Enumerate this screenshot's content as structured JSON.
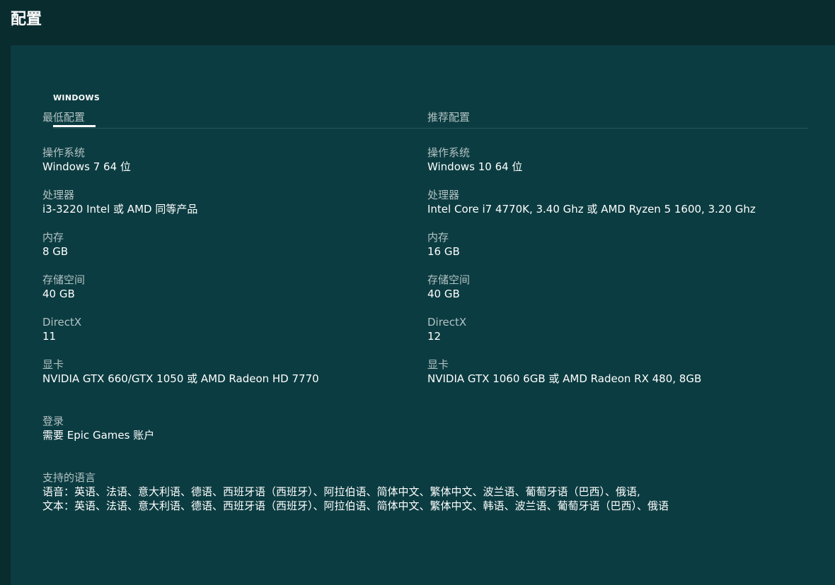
{
  "page": {
    "title": "配置"
  },
  "tabs": [
    {
      "label": "WINDOWS",
      "active": true
    }
  ],
  "minimum": {
    "heading": "最低配置",
    "specs": [
      {
        "label": "操作系统",
        "value": "Windows 7 64 位"
      },
      {
        "label": "处理器",
        "value": "i3-3220 Intel 或 AMD 同等产品"
      },
      {
        "label": "内存",
        "value": "8 GB"
      },
      {
        "label": "存储空间",
        "value": "40 GB"
      },
      {
        "label": "DirectX",
        "value": "11"
      },
      {
        "label": "显卡",
        "value": "NVIDIA GTX 660/GTX 1050 或 AMD Radeon HD 7770"
      }
    ]
  },
  "recommended": {
    "heading": "推荐配置",
    "specs": [
      {
        "label": "操作系统",
        "value": "Windows 10 64 位"
      },
      {
        "label": "处理器",
        "value": "Intel Core i7 4770K, 3.40 Ghz 或 AMD Ryzen 5 1600, 3.20 Ghz"
      },
      {
        "label": "内存",
        "value": "16 GB"
      },
      {
        "label": "存储空间",
        "value": "40 GB"
      },
      {
        "label": "DirectX",
        "value": "12"
      },
      {
        "label": "显卡",
        "value": "NVIDIA GTX 1060 6GB 或 AMD Radeon RX 480, 8GB"
      }
    ]
  },
  "login": {
    "label": "登录",
    "value": "需要 Epic Games 账户"
  },
  "languages": {
    "label": "支持的语言",
    "audio": "语音：英语、法语、意大利语、德语、西班牙语（西班牙）、阿拉伯语、简体中文、繁体中文、波兰语、葡萄牙语（巴西）、俄语,",
    "text": "文本：英语、法语、意大利语、德语、西班牙语（西班牙）、阿拉伯语、简体中文、繁体中文、韩语、波兰语、葡萄牙语（巴西）、俄语"
  },
  "colors": {
    "page_background": "#092c2f",
    "panel_background": "#0b3c41",
    "label_text": "#b3c2c3",
    "value_text": "#ffffff",
    "divider": "#24575b"
  }
}
